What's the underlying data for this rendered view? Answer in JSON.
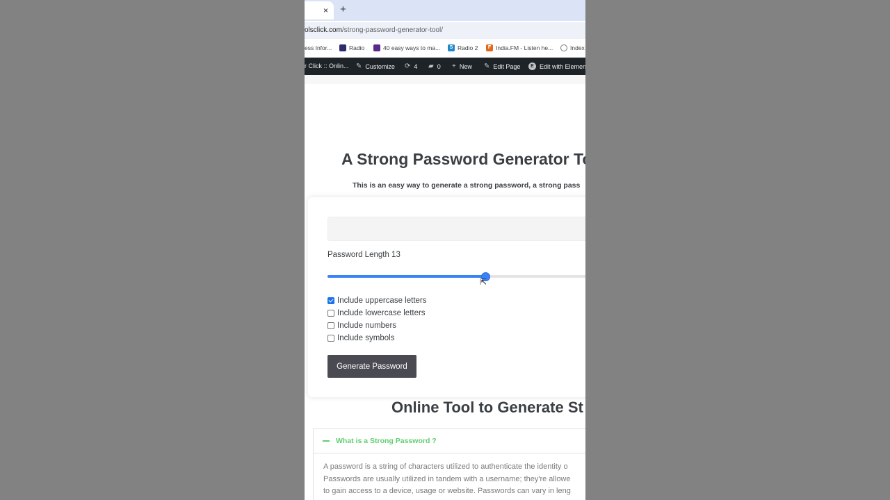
{
  "browser": {
    "tab_close": "×",
    "new_tab": "+",
    "url_host": "olsclick.com",
    "url_path": "/strong-password-generator-tool/"
  },
  "bookmarks": [
    {
      "label": "ess Infor...",
      "icon": "none"
    },
    {
      "label": "Radio",
      "icon": "radio-favicon"
    },
    {
      "label": "40 easy ways to ma...",
      "icon": "bookmark-favicon"
    },
    {
      "label": "Radio 2",
      "icon": "s-favicon"
    },
    {
      "label": "India.FM - Listen he...",
      "icon": "fm-favicon"
    },
    {
      "label": "Index",
      "icon": "globe-icon"
    }
  ],
  "adminbar": {
    "site": "r Click :: Onlin...",
    "customize": "Customize",
    "updates_count": "4",
    "comments_count": "0",
    "new": "New",
    "edit_page": "Edit Page",
    "edit_elementor": "Edit with Elemen"
  },
  "page": {
    "title": "A Strong Password Generator To",
    "subtitle": "This is an easy way to generate a strong password, a strong pass"
  },
  "generator": {
    "password_value": "",
    "length_label": "Password Length 13",
    "length_value": 13,
    "length_fraction": 0.595,
    "options": [
      {
        "label": "Include uppercase letters",
        "checked": true
      },
      {
        "label": "Include lowercase letters",
        "checked": false
      },
      {
        "label": "Include numbers",
        "checked": false
      },
      {
        "label": "Include symbols",
        "checked": false
      }
    ],
    "button_label": "Generate Password"
  },
  "section": {
    "title": "Online Tool to Generate St"
  },
  "faq": {
    "question": "What is a Strong Password ?",
    "answer_lines": [
      "A password is a string of characters utilized to authenticate the identity o",
      "Passwords are usually utilized in tandem with a username; they're allowe",
      "to gain access to a device, usage or website. Passwords can vary in leng"
    ]
  },
  "colors": {
    "accent": "#3b82f6",
    "faq_green": "#61ce70",
    "button_bg": "#4a4a52",
    "adminbar_bg": "#1d2327"
  }
}
